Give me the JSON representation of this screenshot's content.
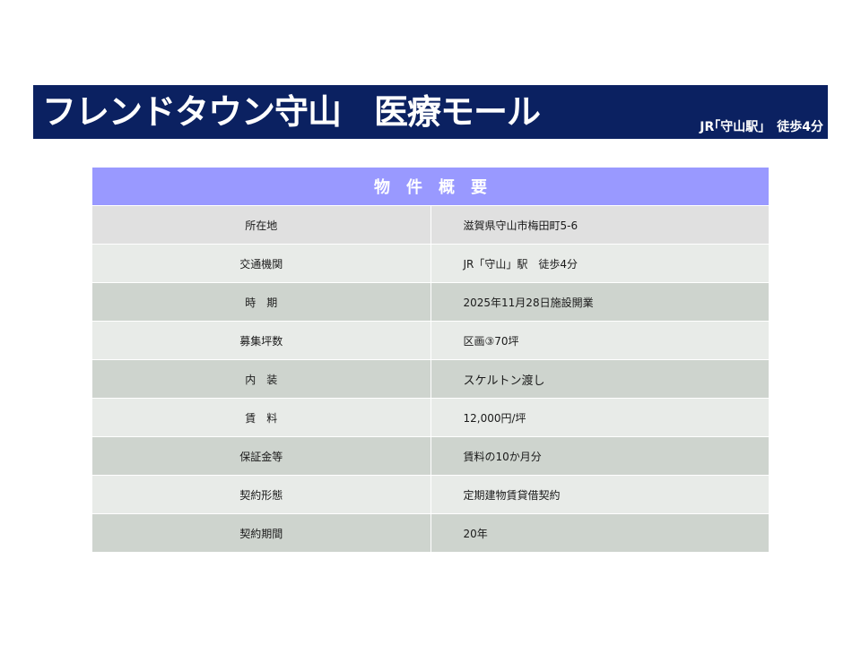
{
  "banner": {
    "title": "フレンドタウン守山　医療モール",
    "access": "JR｢守山駅｣　徒歩4分",
    "color": "#0b2161"
  },
  "table": {
    "header": "物件概要",
    "header_color": "#9999ff",
    "rows": [
      {
        "label": "所在地",
        "value": "滋賀県守山市梅田町5-6"
      },
      {
        "label": "交通機関",
        "value": "JR「守山」駅　徒歩4分"
      },
      {
        "label": "時　期",
        "value": "2025年11月28日施設開業"
      },
      {
        "label": "募集坪数",
        "value": "区画③70坪"
      },
      {
        "label": "内　装",
        "value": "スケルトン渡し"
      },
      {
        "label": "賃　料",
        "value": "12,000円/坪"
      },
      {
        "label": "保証金等",
        "value": "賃料の10か月分"
      },
      {
        "label": "契約形態",
        "value": "定期建物賃貸借契約"
      },
      {
        "label": "契約期間",
        "value": "20年"
      }
    ]
  }
}
